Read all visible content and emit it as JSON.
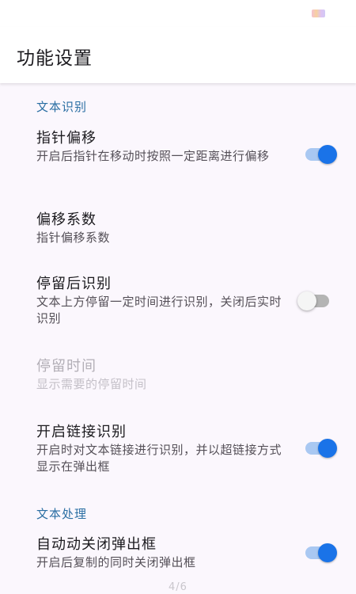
{
  "app_bar": {
    "title": "功能设置"
  },
  "sections": {
    "text_recognition": "文本识别",
    "text_processing": "文本处理"
  },
  "prefs": {
    "pointer_offset": {
      "title": "指针偏移",
      "summary": "开启后指针在移动时按照一定距离进行偏移",
      "enabled": true
    },
    "offset_factor": {
      "title": "偏移系数",
      "summary": "指针偏移系数"
    },
    "recognize_after_hover": {
      "title": "停留后识别",
      "summary": "文本上方停留一定时间进行识别，关闭后实时识别",
      "enabled": false
    },
    "hover_time": {
      "title": "停留时间",
      "summary": "显示需要的停留时间",
      "disabled": true
    },
    "link_recognition": {
      "title": "开启链接识别",
      "summary": "开启时对文本链接进行识别，并以超链接方式显示在弹出框",
      "enabled": true
    },
    "auto_close_popup": {
      "title": "自动动关闭弹出框",
      "summary": "开启后复制的同时关闭弹出框",
      "enabled": true
    }
  },
  "page_indicator": "4/6",
  "colors": {
    "accent": "#1a73e8",
    "section_header": "#2a6ea3",
    "background": "#fbf7fd"
  }
}
